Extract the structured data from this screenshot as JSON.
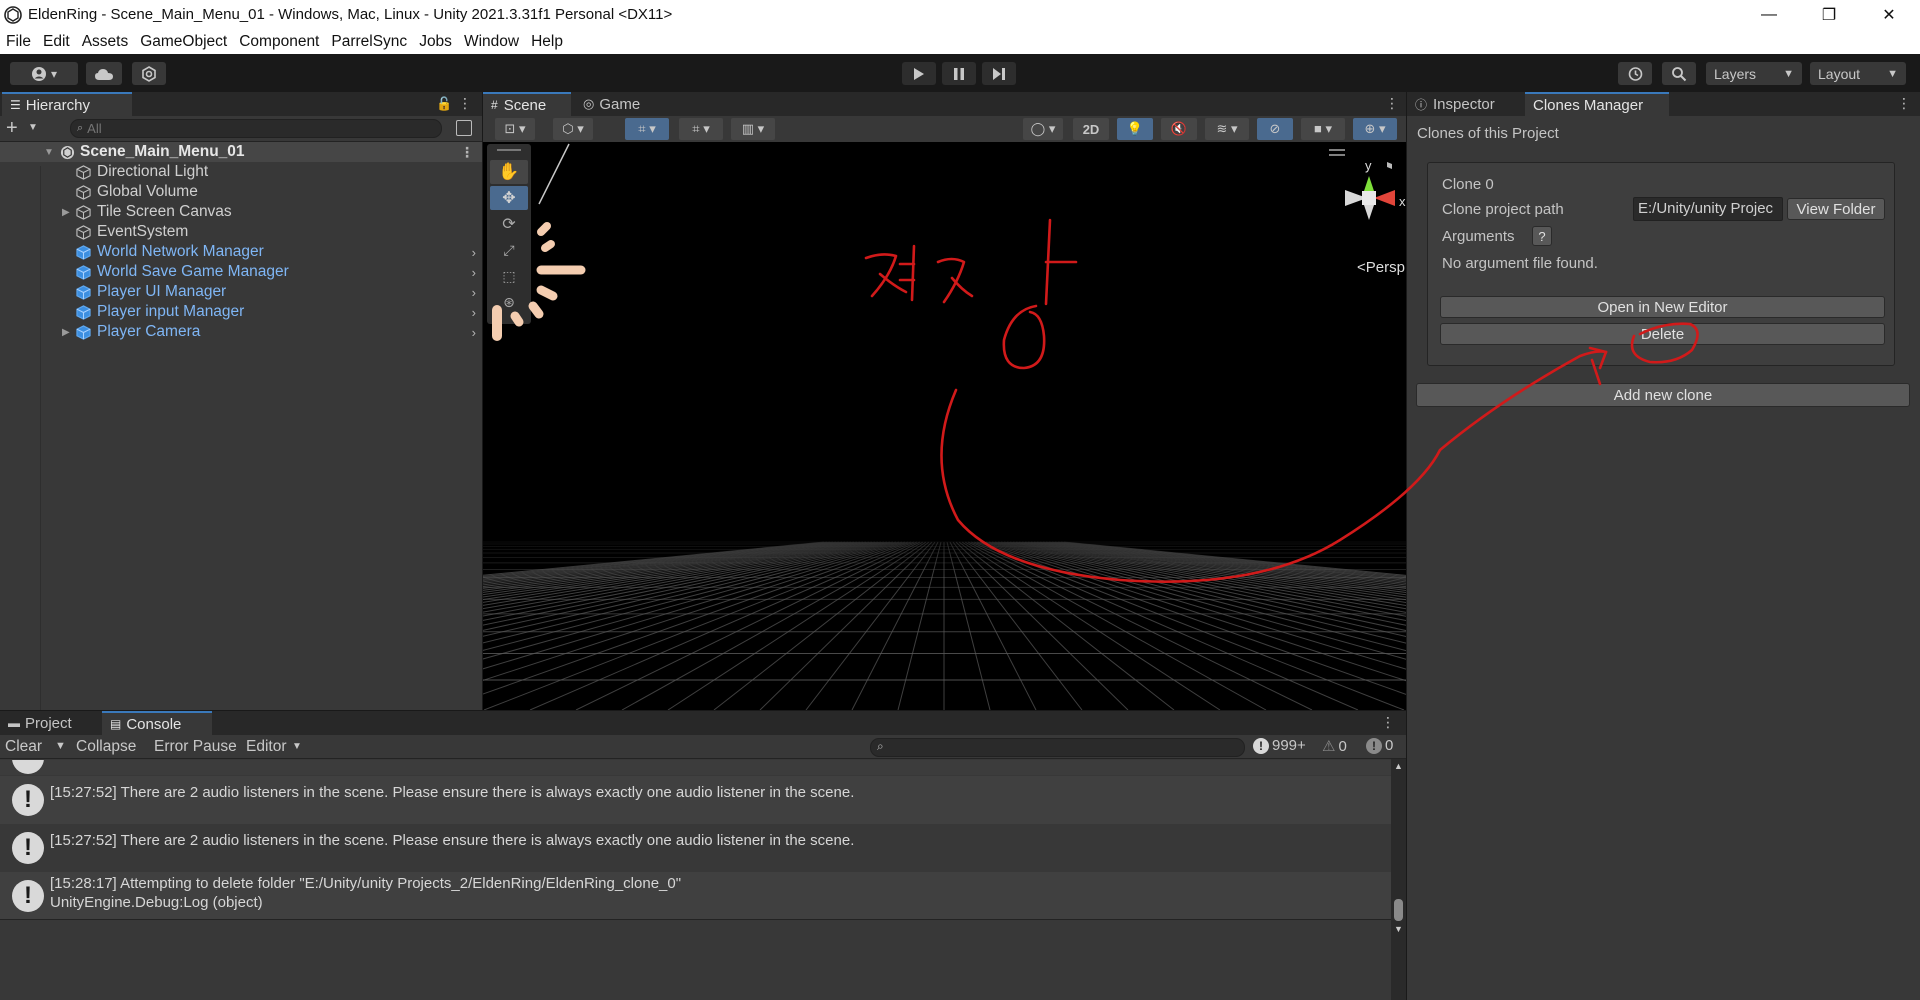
{
  "window": {
    "title": "EldenRing - Scene_Main_Menu_01 - Windows, Mac, Linux - Unity 2021.3.31f1 Personal <DX11>",
    "controls": [
      "—",
      "❐",
      "✕"
    ]
  },
  "menu": [
    "File",
    "Edit",
    "Assets",
    "GameObject",
    "Component",
    "ParrelSync",
    "Jobs",
    "Window",
    "Help"
  ],
  "toolbar": {
    "account_label": "● ▾",
    "layers_label": "Layers",
    "layout_label": "Layout"
  },
  "hierarchy": {
    "tab_label": "Hierarchy",
    "search_placeholder": "All",
    "scene_name": "Scene_Main_Menu_01",
    "items": [
      {
        "label": "Directional Light",
        "prefab": false,
        "expandable": false
      },
      {
        "label": "Global Volume",
        "prefab": false,
        "expandable": false
      },
      {
        "label": "Tile Screen Canvas",
        "prefab": false,
        "expandable": true
      },
      {
        "label": "EventSystem",
        "prefab": false,
        "expandable": false
      },
      {
        "label": "World Network Manager",
        "prefab": true,
        "expandable": false
      },
      {
        "label": "World Save Game Manager",
        "prefab": true,
        "expandable": false
      },
      {
        "label": "Player UI Manager",
        "prefab": true,
        "expandable": false
      },
      {
        "label": "Player input Manager",
        "prefab": true,
        "expandable": false
      },
      {
        "label": "Player Camera",
        "prefab": true,
        "expandable": true
      }
    ]
  },
  "scene": {
    "tabs": [
      "Scene",
      "Game"
    ],
    "twod_label": "2D",
    "persp_label": "<Persp",
    "gizmo_y": "y",
    "gizmo_x": "x",
    "handwritten_note": "저장"
  },
  "rightpanel": {
    "tabs": [
      "Inspector",
      "Clones Manager"
    ],
    "heading": "Clones of this Project",
    "clone_title": "Clone 0",
    "path_label": "Clone project path",
    "path_value": "E:/Unity/unity Projec",
    "view_folder": "View Folder",
    "arguments_label": "Arguments",
    "arguments_help": "?",
    "no_arg": "No argument file found.",
    "open_editor": "Open in New Editor",
    "delete": "Delete",
    "add_clone": "Add new clone"
  },
  "console": {
    "tabs": [
      "Project",
      "Console"
    ],
    "tools": {
      "clear": "Clear",
      "collapse": "Collapse",
      "error_pause": "Error Pause",
      "editor": "Editor"
    },
    "counts": {
      "info": "999+",
      "warn": "0",
      "error": "0"
    },
    "rows": [
      {
        "text": "[15:27:52] There are 2 audio listeners in the scene. Please ensure there is always exactly one audio listener in the scene.",
        "sub": ""
      },
      {
        "text": "[15:27:52] There are 2 audio listeners in the scene. Please ensure there is always exactly one audio listener in the scene.",
        "sub": ""
      },
      {
        "text": "[15:28:17] Attempting to delete folder \"E:/Unity/unity Projects_2/EldenRing/EldenRing_clone_0\"",
        "sub": "UnityEngine.Debug:Log (object)"
      }
    ]
  },
  "colors": {
    "prefab_text": "#7fb6f5",
    "annotation": "#d11a1a",
    "accent": "#3a79bb"
  }
}
